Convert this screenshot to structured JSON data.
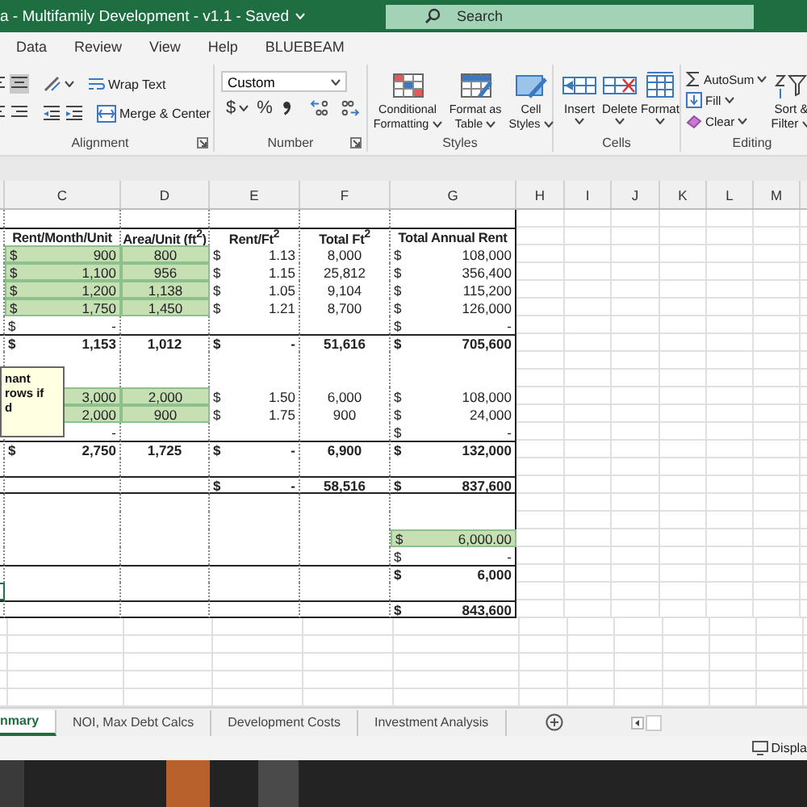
{
  "title_bar": {
    "title": "a - Multifamily Development - v1.1 -  Saved",
    "search": {
      "placeholder": "Search"
    }
  },
  "menu_tabs": [
    {
      "label": "Data"
    },
    {
      "label": "Review"
    },
    {
      "label": "View"
    },
    {
      "label": "Help"
    },
    {
      "label": "BLUEBEAM"
    }
  ],
  "ribbon": {
    "alignment": {
      "label": "Alignment",
      "align_buttons": [
        {
          "selected": false
        },
        {
          "selected": true
        }
      ],
      "wrap_text": "Wrap Text",
      "merge": "Merge & Center"
    },
    "number": {
      "label": "Number",
      "format": "Custom",
      "currency": "$",
      "percent": "%"
    },
    "styles": {
      "label": "Styles",
      "buttons": [
        "Conditional Formatting",
        "Format as Table",
        "Cell Styles"
      ]
    },
    "cells": {
      "label": "Cells",
      "buttons": [
        "Insert",
        "Delete",
        "Format"
      ]
    },
    "editing": {
      "label": "Editing",
      "autosum": "AutoSum",
      "fill": "Fill",
      "clear": "Clear",
      "sort": "Sort & Filter"
    }
  },
  "sheet": {
    "columns": [
      "C",
      "D",
      "E",
      "F",
      "G",
      "H",
      "I",
      "J",
      "K",
      "L",
      "M"
    ],
    "rows": [
      {
        "kind": "blank"
      },
      {
        "kind": "header",
        "cells": [
          {
            "value": "Rent/Month/Unit"
          },
          {
            "value": "Area/Unit (ft$^{2}$)"
          },
          {
            "value": "Rent/Ft$^{2}$"
          },
          {
            "value": "Total Ft$^{2}$"
          },
          {
            "value": "Total Annual Rent"
          }
        ]
      },
      {
        "kind": "data",
        "cells": [
          {
            "dollar": "$",
            "value": "900",
            "input": true
          },
          {
            "value": "800",
            "input": true
          },
          {
            "dollar": "$",
            "value": "1.13"
          },
          {
            "value": "8,000"
          },
          {
            "dollar": "$",
            "value": "108,000"
          }
        ]
      },
      {
        "kind": "data",
        "cells": [
          {
            "dollar": "$",
            "value": "1,100",
            "input": true
          },
          {
            "value": "956",
            "input": true
          },
          {
            "dollar": "$",
            "value": "1.15"
          },
          {
            "value": "25,812"
          },
          {
            "dollar": "$",
            "value": "356,400"
          }
        ]
      },
      {
        "kind": "data",
        "cells": [
          {
            "dollar": "$",
            "value": "1,200",
            "input": true
          },
          {
            "value": "1,138",
            "input": true
          },
          {
            "dollar": "$",
            "value": "1.05"
          },
          {
            "value": "9,104"
          },
          {
            "dollar": "$",
            "value": "115,200"
          }
        ]
      },
      {
        "kind": "data",
        "cells": [
          {
            "dollar": "$",
            "value": "1,750",
            "input": true
          },
          {
            "value": "1,450",
            "input": true
          },
          {
            "dollar": "$",
            "value": "1.21"
          },
          {
            "value": "8,700"
          },
          {
            "dollar": "$",
            "value": "126,000"
          }
        ]
      },
      {
        "kind": "data",
        "cells": [
          {
            "dollar": "$",
            "value": "-"
          },
          {},
          {},
          {},
          {
            "dollar": "$",
            "value": "-"
          }
        ]
      },
      {
        "kind": "total",
        "cells": [
          {
            "dollar": "$",
            "value": "1,153"
          },
          {
            "value": "1,012"
          },
          {
            "dollar": "$",
            "value": "-"
          },
          {
            "value": "51,616"
          },
          {
            "dollar": "$",
            "value": "705,600"
          }
        ]
      },
      {
        "kind": "blank"
      },
      {
        "kind": "blank"
      },
      {
        "kind": "data",
        "cells": [
          {
            "value": "3,000",
            "input": true
          },
          {
            "value": "2,000",
            "input": true
          },
          {
            "dollar": "$",
            "value": "1.50"
          },
          {
            "value": "6,000"
          },
          {
            "dollar": "$",
            "value": "108,000"
          }
        ]
      },
      {
        "kind": "data",
        "cells": [
          {
            "value": "2,000",
            "input": true
          },
          {
            "value": "900",
            "input": true
          },
          {
            "dollar": "$",
            "value": "1.75"
          },
          {
            "value": "900"
          },
          {
            "dollar": "$",
            "value": "24,000"
          }
        ]
      },
      {
        "kind": "data",
        "cells": [
          {
            "value": "-"
          },
          {},
          {},
          {},
          {
            "dollar": "$",
            "value": "-"
          }
        ]
      },
      {
        "kind": "total",
        "cells": [
          {
            "dollar": "$",
            "value": "2,750"
          },
          {
            "value": "1,725"
          },
          {
            "dollar": "$",
            "value": "-"
          },
          {
            "value": "6,900"
          },
          {
            "dollar": "$",
            "value": "132,000"
          }
        ]
      },
      {
        "kind": "blank"
      },
      {
        "kind": "grand",
        "cells": [
          {},
          {},
          {
            "dollar": "$",
            "value": "-"
          },
          {
            "value": "58,516"
          },
          {
            "dollar": "$",
            "value": "837,600"
          }
        ]
      },
      {
        "kind": "blank"
      },
      {
        "kind": "blank"
      },
      {
        "kind": "data",
        "cells": [
          {},
          {},
          {},
          {},
          {
            "dollar": "$",
            "value": "6,000.00",
            "input": true
          }
        ]
      },
      {
        "kind": "data",
        "cells": [
          {},
          {},
          {},
          {},
          {
            "dollar": "$",
            "value": "-"
          }
        ]
      },
      {
        "kind": "total",
        "cells": [
          {},
          {},
          {},
          {},
          {
            "dollar": "$",
            "value": "6,000"
          }
        ]
      },
      {
        "kind": "blank",
        "active": true
      },
      {
        "kind": "grand",
        "cells": [
          {},
          {},
          {},
          {},
          {
            "dollar": "$",
            "value": "843,600"
          }
        ]
      }
    ],
    "comment": {
      "text": "nant\nrows if\nd"
    }
  },
  "sheet_tabs": [
    {
      "label": "nmary",
      "selected": true
    },
    {
      "label": "NOI, Max Debt Calcs",
      "selected": false
    },
    {
      "label": "Development Costs",
      "selected": false
    },
    {
      "label": "Investment Analysis",
      "selected": false
    }
  ],
  "status_bar": {
    "display_settings": "Displa"
  }
}
